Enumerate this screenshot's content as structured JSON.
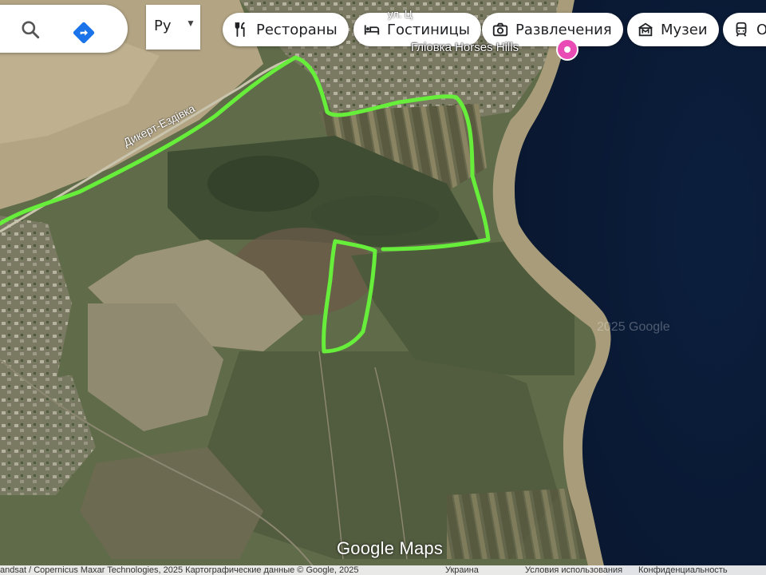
{
  "search": {
    "search_icon": "search-icon",
    "directions_icon": "directions-icon"
  },
  "language": {
    "label": "Ру",
    "icon": "caret-down-icon"
  },
  "chips": [
    {
      "label": "Рестораны",
      "icon": "fork-knife-icon"
    },
    {
      "label": "Гостиницы",
      "icon": "bed-icon"
    },
    {
      "label": "Развлечения",
      "icon": "camera-icon"
    },
    {
      "label": "Музеи",
      "icon": "museum-icon"
    },
    {
      "label": "О",
      "icon": "train-icon"
    }
  ],
  "map": {
    "place_label": "Гліовка Horses Hills",
    "road_label_main": "Дикерт-Ездівка",
    "road_label_top": "ул. Ц",
    "watermark": "2025 Google",
    "route_color": "#66ee3a",
    "water_color": "#0a1a33",
    "pin_color": "#e94cb5"
  },
  "branding": {
    "logo": "Google Maps"
  },
  "footer": {
    "attribution": "andsat / Copernicus Maxar Technologies, 2025 Картографические данные © Google, 2025",
    "country": "Украина",
    "terms": "Условия использования",
    "privacy": "Конфиденциальность"
  }
}
